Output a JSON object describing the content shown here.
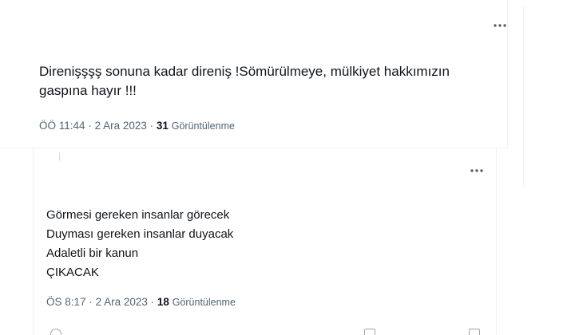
{
  "outer_tweet": {
    "more_icon": "more-horizontal-icon",
    "text": "Direnişşşş sonuna kadar direniş !Sömürülmeye, mülkiyet hakkımızın gaspına hayır !!!",
    "time": "ÖÖ 11:44",
    "separator": "·",
    "date": "2 Ara 2023",
    "views_count": "31",
    "views_label": "Görüntülenme"
  },
  "reply_tweet": {
    "more_icon": "more-horizontal-icon",
    "lines": [
      "Görmesi gereken insanlar görecek",
      "Duyması gereken insanlar duyacak",
      "Adaletli bir kanun",
      "ÇIKACAK"
    ],
    "time": "ÖS 8:17",
    "separator": "·",
    "date": "2 Ara 2023",
    "views_count": "18",
    "views_label": "Görüntülenme"
  },
  "colors": {
    "text": "#0f1419",
    "secondary": "#536471",
    "border": "#eff3f4"
  }
}
